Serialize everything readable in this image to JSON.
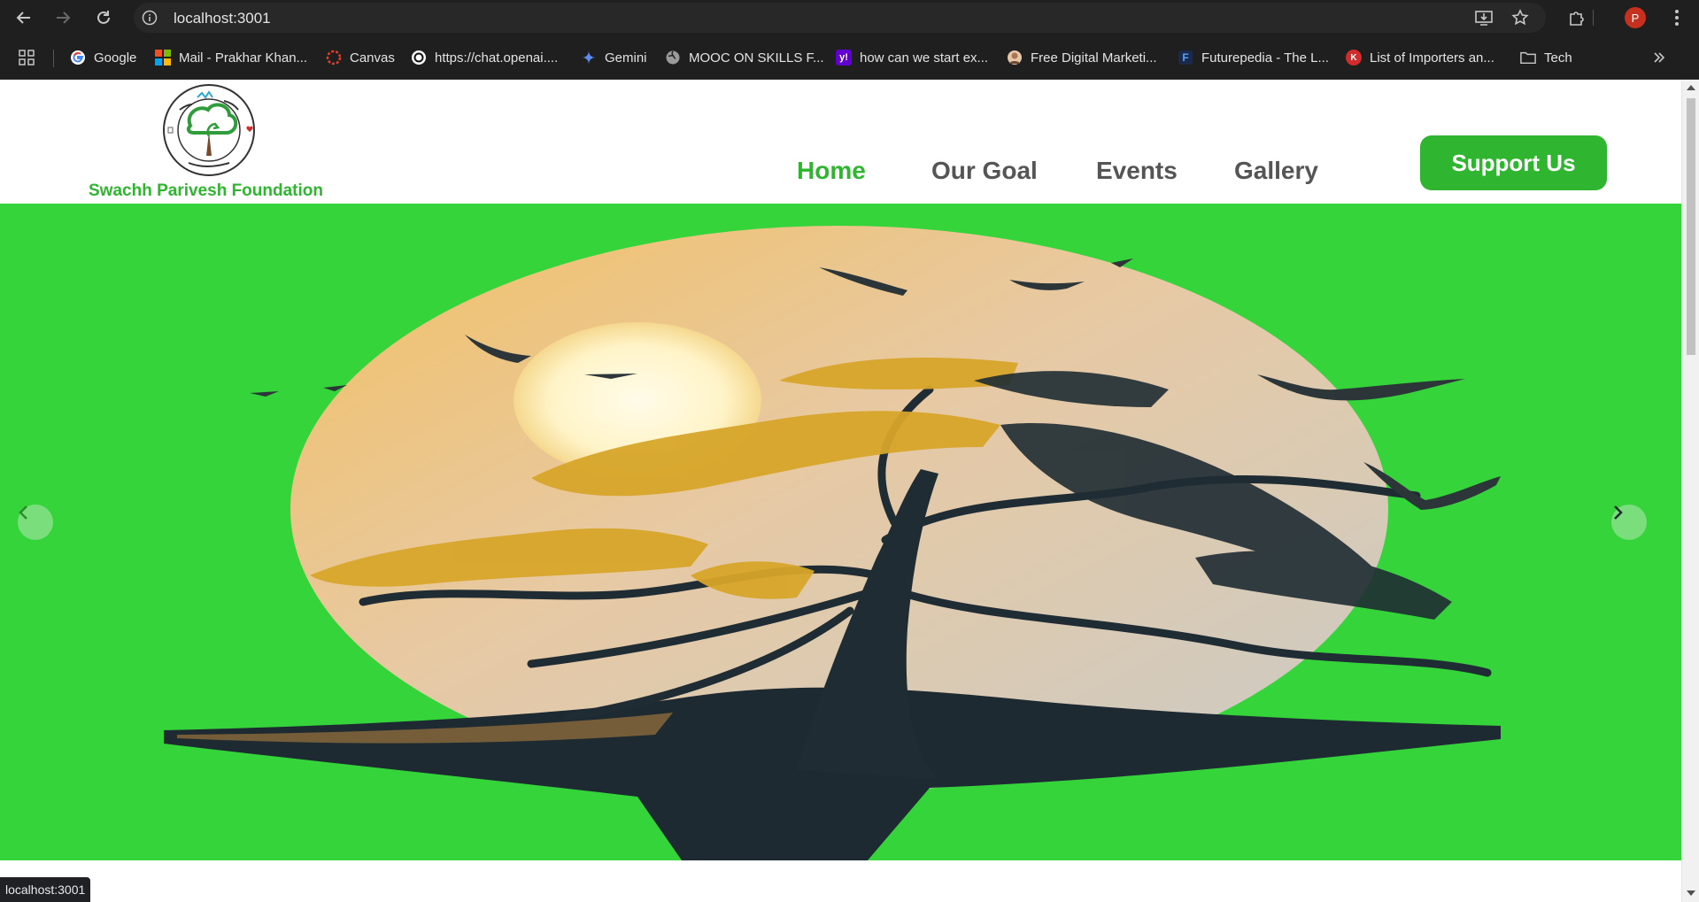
{
  "browser": {
    "url": "localhost:3001",
    "profile_initial": "P",
    "bookmarks": [
      {
        "label": "Google",
        "icon": "google-icon"
      },
      {
        "label": "Mail - Prakhar Khan...",
        "icon": "microsoft-icon"
      },
      {
        "label": "Canvas",
        "icon": "canvas-icon"
      },
      {
        "label": "https://chat.openai....",
        "icon": "openai-icon"
      },
      {
        "label": "Gemini",
        "icon": "gemini-icon"
      },
      {
        "label": "MOOC ON SKILLS F...",
        "icon": "globe-icon"
      },
      {
        "label": "how can we start ex...",
        "icon": "yahoo-icon"
      },
      {
        "label": "Free Digital Marketi...",
        "icon": "avatar-icon"
      },
      {
        "label": "Futurepedia - The L...",
        "icon": "futurepedia-icon"
      },
      {
        "label": "List of Importers an...",
        "icon": "importers-icon"
      },
      {
        "label": "Tech",
        "icon": "folder-icon"
      }
    ],
    "status_text": "localhost:3001"
  },
  "site": {
    "brand": "Swachh Parivesh Foundation",
    "nav": [
      {
        "label": "Home",
        "active": true
      },
      {
        "label": "Our Goal",
        "active": false
      },
      {
        "label": "Events",
        "active": false
      },
      {
        "label": "Gallery",
        "active": false
      }
    ],
    "cta": "Support Us"
  },
  "colors": {
    "brand_green": "#2fb52f",
    "hero_background": "#35d43b",
    "nav_inactive": "#555555"
  }
}
